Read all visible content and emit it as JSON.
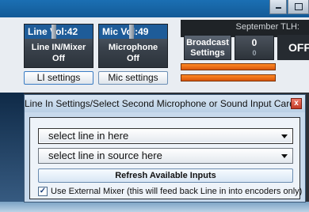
{
  "header": {
    "tlh_label": "September TLH:"
  },
  "line_panel": {
    "vol_label": "Line Vol:42",
    "toggle_label": "Line IN/Mixer",
    "toggle_state": "Off",
    "settings_label": "LI settings"
  },
  "mic_panel": {
    "vol_label": "Mic Vol:49",
    "toggle_label": "Microphone",
    "toggle_state": "Off",
    "settings_label": "Mic settings"
  },
  "broadcast": {
    "label_line1": "Broadcast",
    "label_line2": "Settings",
    "count": "0",
    "count_sub": "0",
    "state": "OFF"
  },
  "dialog": {
    "title": "Line In Settings/Select Second Microphone or Sound Input Card",
    "close_label": "x",
    "line_in_select": "select line in here",
    "line_source_select": "select line in source here",
    "refresh_label": "Refresh Available Inputs",
    "external_mixer_checked": true,
    "external_mixer_label": "Use External Mixer (this will feed back Line in into encoders only)"
  },
  "colors": {
    "accent_blue": "#1e5c99",
    "meter_orange": "#ff8a26",
    "close_red": "#c33a25"
  }
}
